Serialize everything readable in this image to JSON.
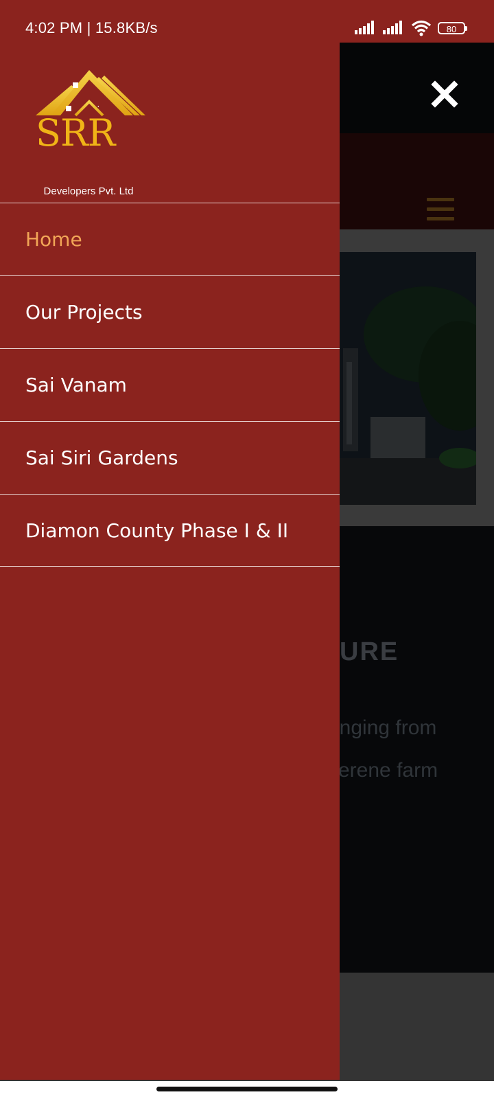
{
  "status_bar": {
    "time_speed": "4:02 PM | 15.8KB/s",
    "battery": "80"
  },
  "logo": {
    "brand": "SRR",
    "tagline": "Developers Pvt. Ltd"
  },
  "menu": {
    "items": [
      {
        "label": "Home"
      },
      {
        "label": "Our Projects"
      },
      {
        "label": "Sai Vanam"
      },
      {
        "label": "Sai Siri Gardens"
      },
      {
        "label": "Diamon County Phase I & II"
      }
    ]
  },
  "background": {
    "heading_fragment": "URE",
    "text_line_1": "anging from",
    "text_line_2": "serene farm"
  },
  "colors": {
    "drawer": "#8b231e",
    "active_item": "#f1a657",
    "logo_gold": "#f0b417"
  }
}
